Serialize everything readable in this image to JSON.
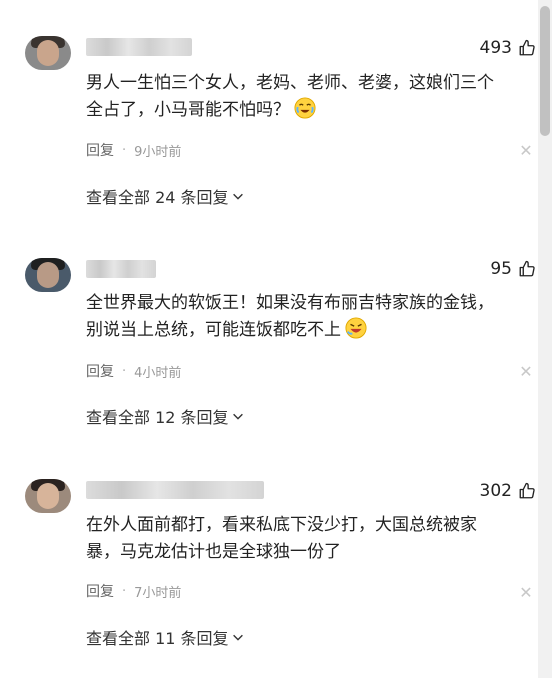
{
  "colors": {
    "text": "#222222",
    "meta": "#999999",
    "emoji_face": "#ffd23f"
  },
  "comments": [
    {
      "likes": "493",
      "text_lines": [
        "男人一生怕三个女人，老妈、老师、老婆，这娘们三个",
        "全占了，小马哥能不怕吗？"
      ],
      "emoji": "crying-laugh-emoji",
      "reply_label": "回复",
      "time": "9小时前",
      "view_replies": "查看全部 24 条回复"
    },
    {
      "likes": "95",
      "text_lines": [
        "全世界最大的软饭王！如果没有布丽吉特家族的金钱，",
        "别说当上总统，可能连饭都吃不上"
      ],
      "emoji": "rolling-laugh-emoji",
      "reply_label": "回复",
      "time": "4小时前",
      "view_replies": "查看全部 12 条回复"
    },
    {
      "likes": "302",
      "text_lines": [
        "在外人面前都打，看来私底下没少打，大国总统被家",
        "暴，马克龙估计也是全球独一份了"
      ],
      "reply_label": "回复",
      "time": "7小时前",
      "view_replies": "查看全部 11 条回复"
    }
  ],
  "icons": {
    "like": "thumbs-up-icon",
    "dismiss": "close-icon",
    "expand": "chevron-down-icon"
  }
}
